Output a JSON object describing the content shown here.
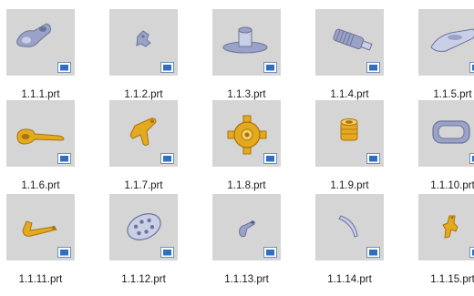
{
  "files": [
    {
      "name": "1.1.1.prt",
      "icon": "part-bracket-grey-icon"
    },
    {
      "name": "1.1.2.prt",
      "icon": "part-small-clip-icon"
    },
    {
      "name": "1.1.3.prt",
      "icon": "part-flange-disc-icon"
    },
    {
      "name": "1.1.4.prt",
      "icon": "part-threaded-bolt-icon"
    },
    {
      "name": "1.1.5.prt",
      "icon": "part-wedge-block-icon"
    },
    {
      "name": "1.1.6.prt",
      "icon": "part-gold-wrench-icon"
    },
    {
      "name": "1.1.7.prt",
      "icon": "part-gold-lever-icon"
    },
    {
      "name": "1.1.8.prt",
      "icon": "part-gold-gear-icon"
    },
    {
      "name": "1.1.9.prt",
      "icon": "part-gold-cylinder-icon"
    },
    {
      "name": "1.1.10.prt",
      "icon": "part-rounded-frame-icon"
    },
    {
      "name": "1.1.11.prt",
      "icon": "part-gold-arm-icon"
    },
    {
      "name": "1.1.12.prt",
      "icon": "part-perforated-plate-icon"
    },
    {
      "name": "1.1.13.prt",
      "icon": "part-small-hook-icon"
    },
    {
      "name": "1.1.14.prt",
      "icon": "part-curved-rod-icon"
    },
    {
      "name": "1.1.15.prt",
      "icon": "part-gold-link-icon"
    }
  ],
  "colors": {
    "thumbnail_bg": "#d5d5d5",
    "steel": "#9aa3c7",
    "gold": "#e3a91f",
    "badge_blue": "#2e6fc4"
  }
}
